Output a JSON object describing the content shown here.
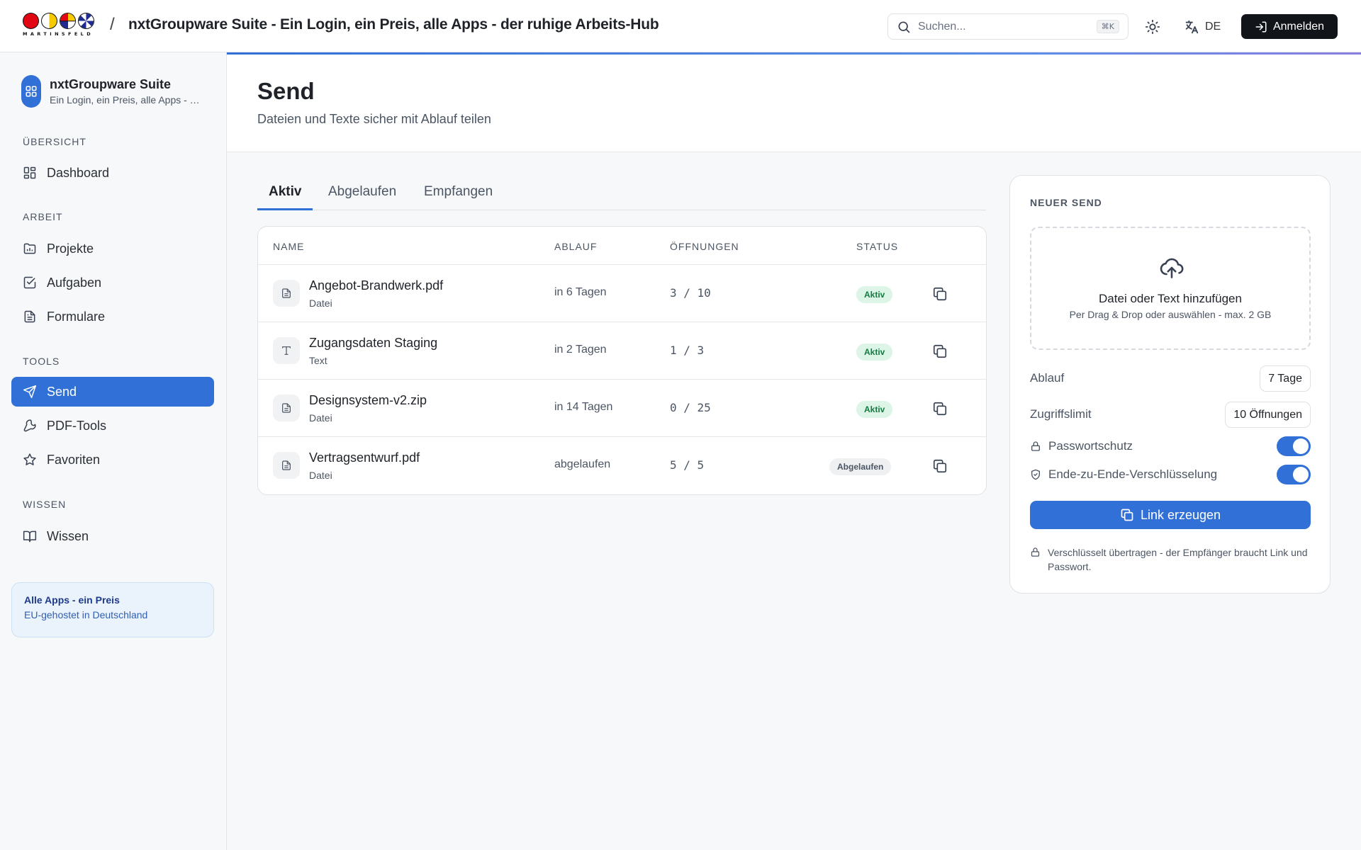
{
  "topbar": {
    "logo_wordmark": "MARTINSFELD",
    "separator": "/",
    "title": "nxtGroupware Suite - Ein Login, ein Preis, alle Apps - der ruhige Arbeits-Hub",
    "search_placeholder": "Suchen...",
    "search_shortcut": "⌘K",
    "language": "DE",
    "login_label": "Anmelden"
  },
  "sidebar": {
    "brand_name": "nxtGroupware Suite",
    "brand_sub": "Ein Login, ein Preis, alle Apps - der ruhige Arbeits-Hub",
    "sections": {
      "overview": "ÜBERSICHT",
      "work": "ARBEIT",
      "tools": "TOOLS",
      "knowledge": "WISSEN"
    },
    "items": {
      "dashboard": "Dashboard",
      "projects": "Projekte",
      "tasks": "Aufgaben",
      "forms": "Formulare",
      "send": "Send",
      "pdf_tools": "PDF-Tools",
      "favorites": "Favoriten",
      "knowledge": "Wissen"
    },
    "promo_title": "Alle Apps - ein Preis",
    "promo_sub": "EU-gehostet in Deutschland"
  },
  "page": {
    "title": "Send",
    "subtitle": "Dateien und Texte sicher mit Ablauf teilen"
  },
  "tabs": [
    "Aktiv",
    "Abgelaufen",
    "Empfangen"
  ],
  "table": {
    "headers": {
      "name": "NAME",
      "expiry": "ABLAUF",
      "opens": "ÖFFNUNGEN",
      "status": "STATUS"
    },
    "rows": [
      {
        "name": "Angebot-Brandwerk.pdf",
        "type": "Datei",
        "expiry": "in 6 Tagen",
        "opens": "3 / 10",
        "status": "Aktiv",
        "icon": "file-icon"
      },
      {
        "name": "Zugangsdaten Staging",
        "type": "Text",
        "expiry": "in 2 Tagen",
        "opens": "1 / 3",
        "status": "Aktiv",
        "icon": "text-icon"
      },
      {
        "name": "Designsystem-v2.zip",
        "type": "Datei",
        "expiry": "in 14 Tagen",
        "opens": "0 / 25",
        "status": "Aktiv",
        "icon": "file-icon"
      },
      {
        "name": "Vertragsentwurf.pdf",
        "type": "Datei",
        "expiry": "abgelaufen",
        "opens": "5 / 5",
        "status": "Abgelaufen",
        "icon": "file-icon"
      }
    ]
  },
  "new_send": {
    "label": "NEUER SEND",
    "drop_title": "Datei oder Text hinzufügen",
    "drop_sub": "Per Drag & Drop oder auswählen - max. 2 GB",
    "expiry_label": "Ablauf",
    "expiry_value": "7 Tage",
    "limit_label": "Zugriffslimit",
    "limit_value": "10 Öffnungen",
    "password_label": "Passwortschutz",
    "password_on": true,
    "e2e_label": "Ende-zu-Ende-Verschlüsselung",
    "e2e_on": true,
    "cta_label": "Link erzeugen",
    "note": "Verschlüsselt übertragen - der Empfänger braucht Link und Passwort."
  },
  "colors": {
    "accent": "#3170d6",
    "active_badge_bg": "#dcf5e6",
    "active_badge_text": "#157a42",
    "dark_button": "#111418"
  }
}
